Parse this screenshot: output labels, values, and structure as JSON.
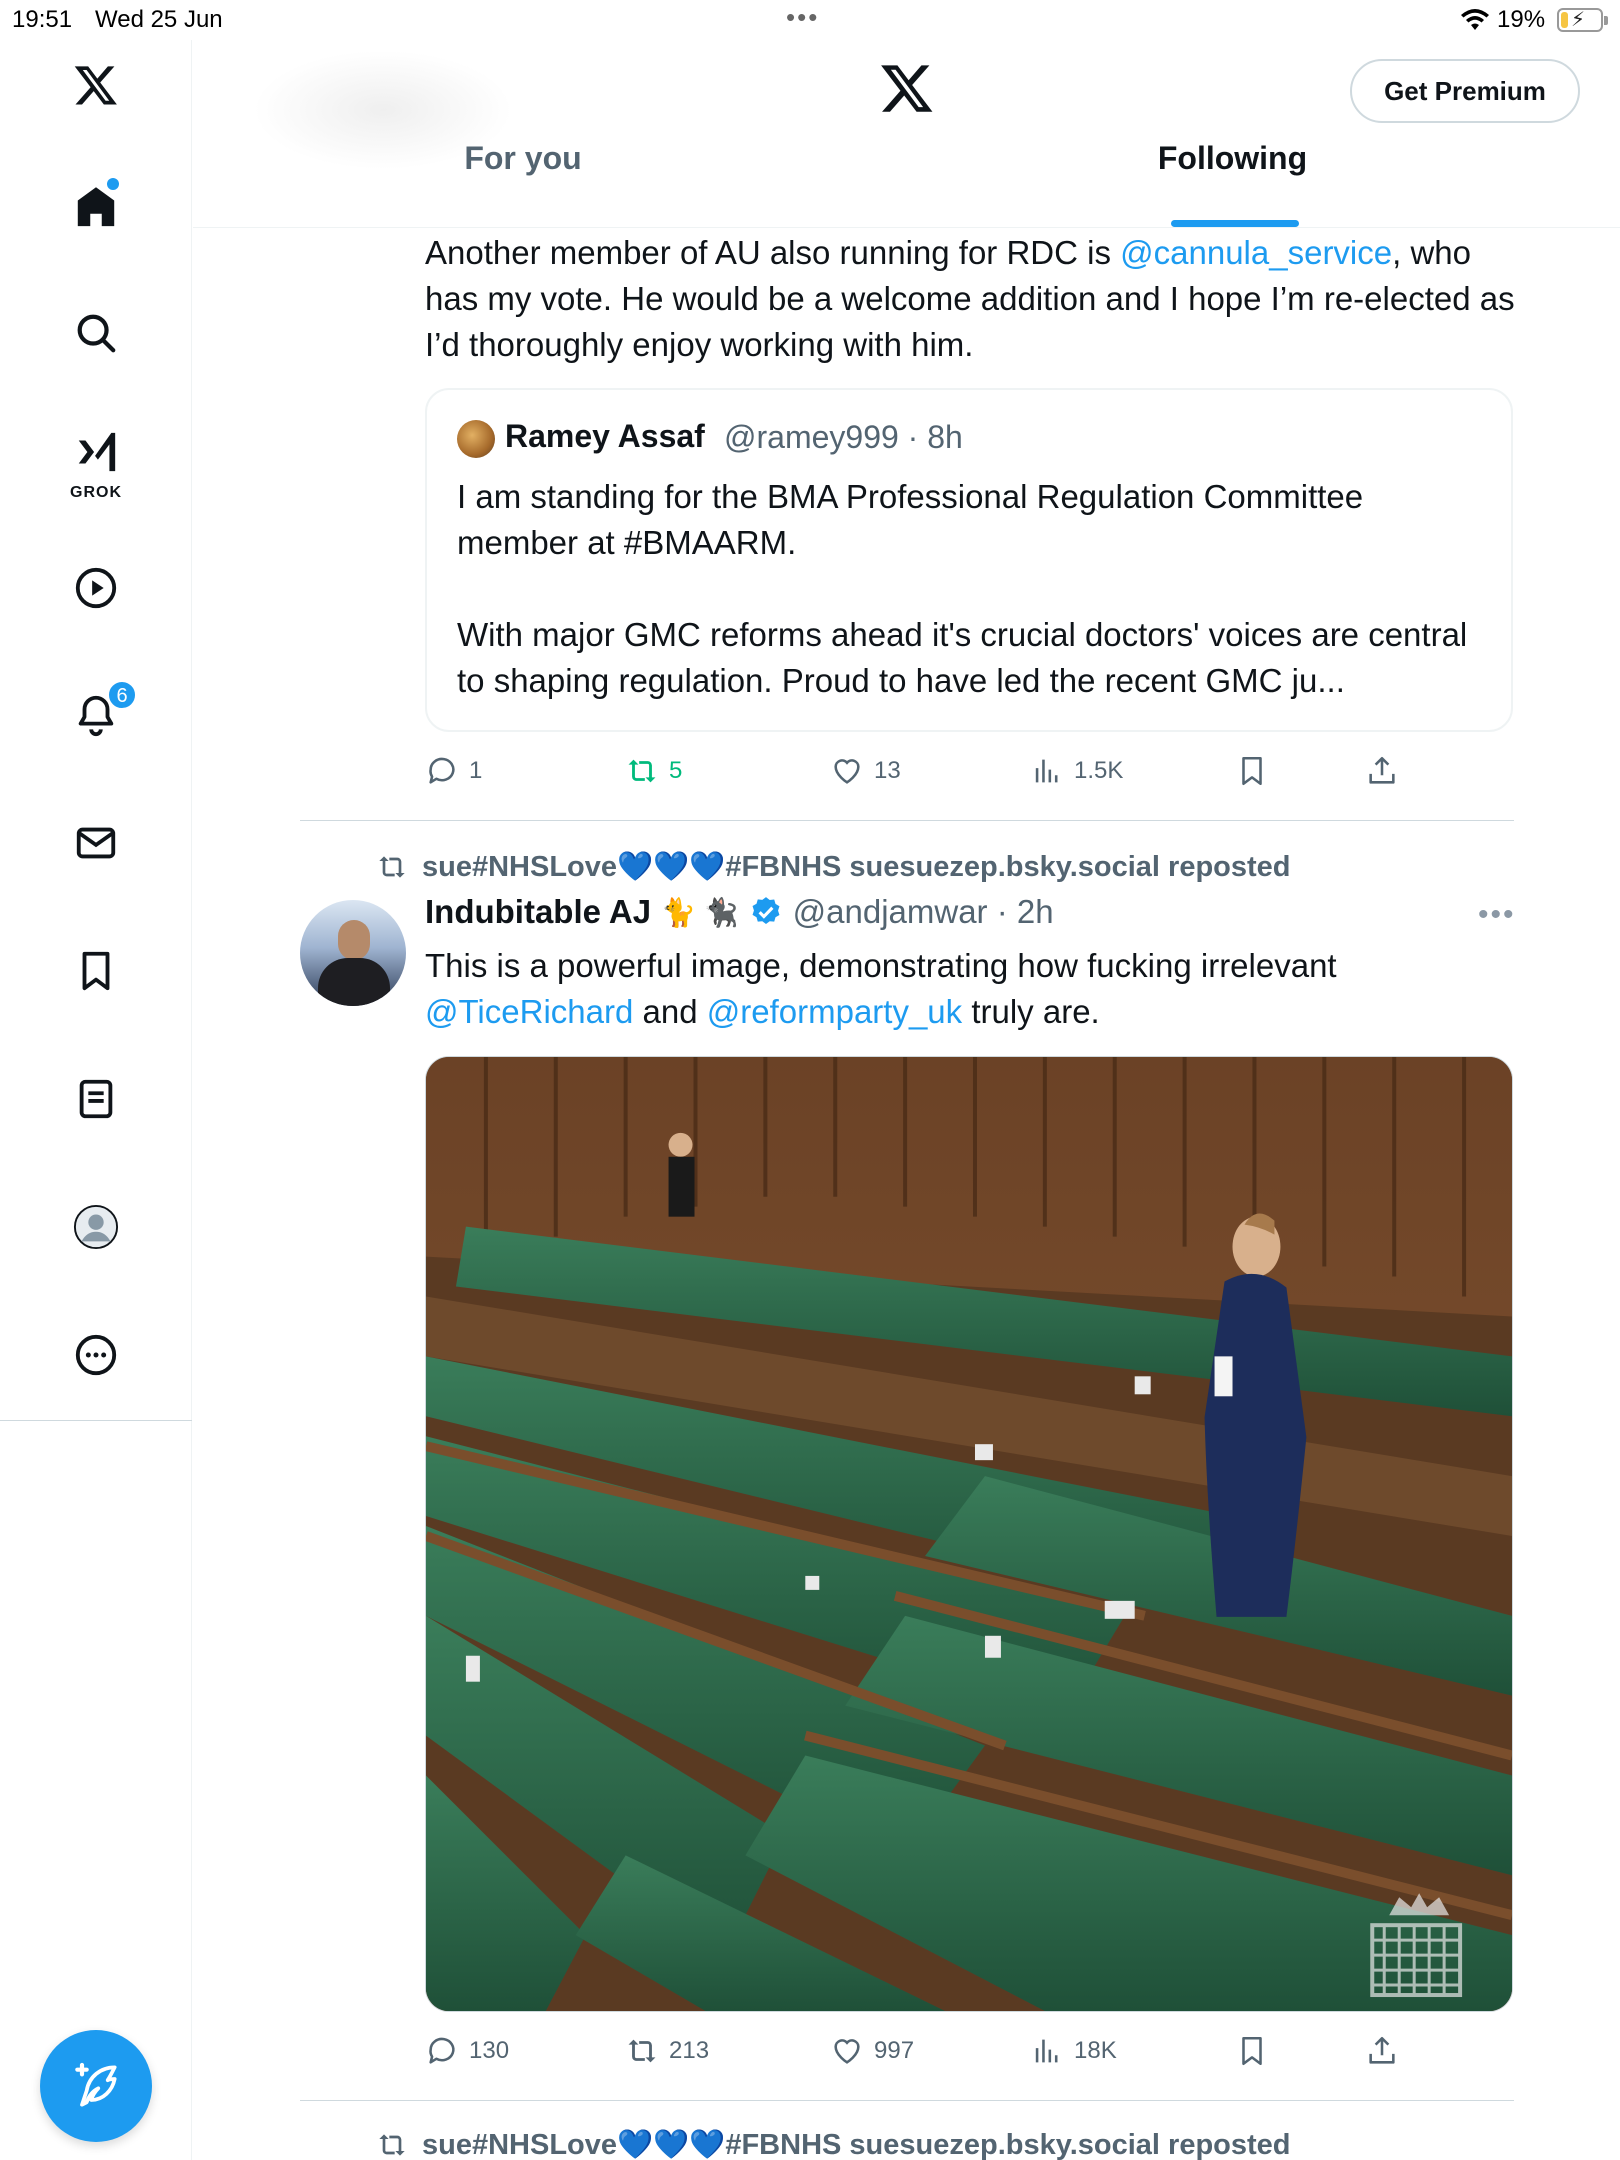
{
  "status_bar": {
    "time": "19:51",
    "date": "Wed 25 Jun",
    "battery": "19%",
    "battery_level": 0.19
  },
  "sidebar": {
    "grok_label": "GROK",
    "notifications_badge": "6",
    "items": [
      "x-logo",
      "home",
      "search",
      "grok",
      "videos",
      "notifications",
      "messages",
      "bookmarks",
      "lists",
      "profile",
      "more"
    ]
  },
  "header": {
    "premium_label": "Get Premium",
    "tabs": [
      {
        "label": "For you",
        "active": false
      },
      {
        "label": "Following",
        "active": true
      }
    ]
  },
  "tweet1": {
    "text_before_link": "Another member of AU also running for RDC is ",
    "mention": "@cannula_service",
    "text_after_link": ", who has my vote. He would be a welcome addition and I hope I’m re-elected as I’d thoroughly enjoy working with him.",
    "quote": {
      "name": "Ramey Assaf",
      "handle_time": "@ramey999 · 8h",
      "line1": "I am standing for the BMA Professional Regulation Committee member at #BMAARM.",
      "line2": "With major GMC reforms ahead it's crucial doctors' voices are central to shaping regulation. Proud to have led the recent GMC ju..."
    },
    "actions": {
      "replies": "1",
      "reposts": "5",
      "likes": "13",
      "views": "1.5K"
    }
  },
  "tweet2": {
    "reposted_by": "sue#NHSLove",
    "reposted_suffix": "#FBNHS suesuezep.bsky.social reposted",
    "name": "Indubitable AJ",
    "name_emoji": "🐈 🐈‍⬛",
    "handle_time": "@andjamwar · 2h",
    "text_part1": "This is a powerful image, demonstrating how fucking irrelevant ",
    "mention1": "@TiceRichard",
    "text_part2": " and ",
    "mention2": "@reformparty_uk",
    "text_part3": " truly are.",
    "media_alt_icon": "commons-chamber-photo",
    "actions": {
      "replies": "130",
      "reposts": "213",
      "likes": "997",
      "views": "18K"
    }
  },
  "tweet3": {
    "reposted_by": "sue#NHSLove",
    "reposted_suffix": "#FBNHS suesuezep.bsky.social reposted"
  },
  "colors": {
    "accent": "#1d9bf0",
    "repost_green": "#00ba7c",
    "muted": "#536471",
    "bench_green": "#2f6b4c"
  }
}
